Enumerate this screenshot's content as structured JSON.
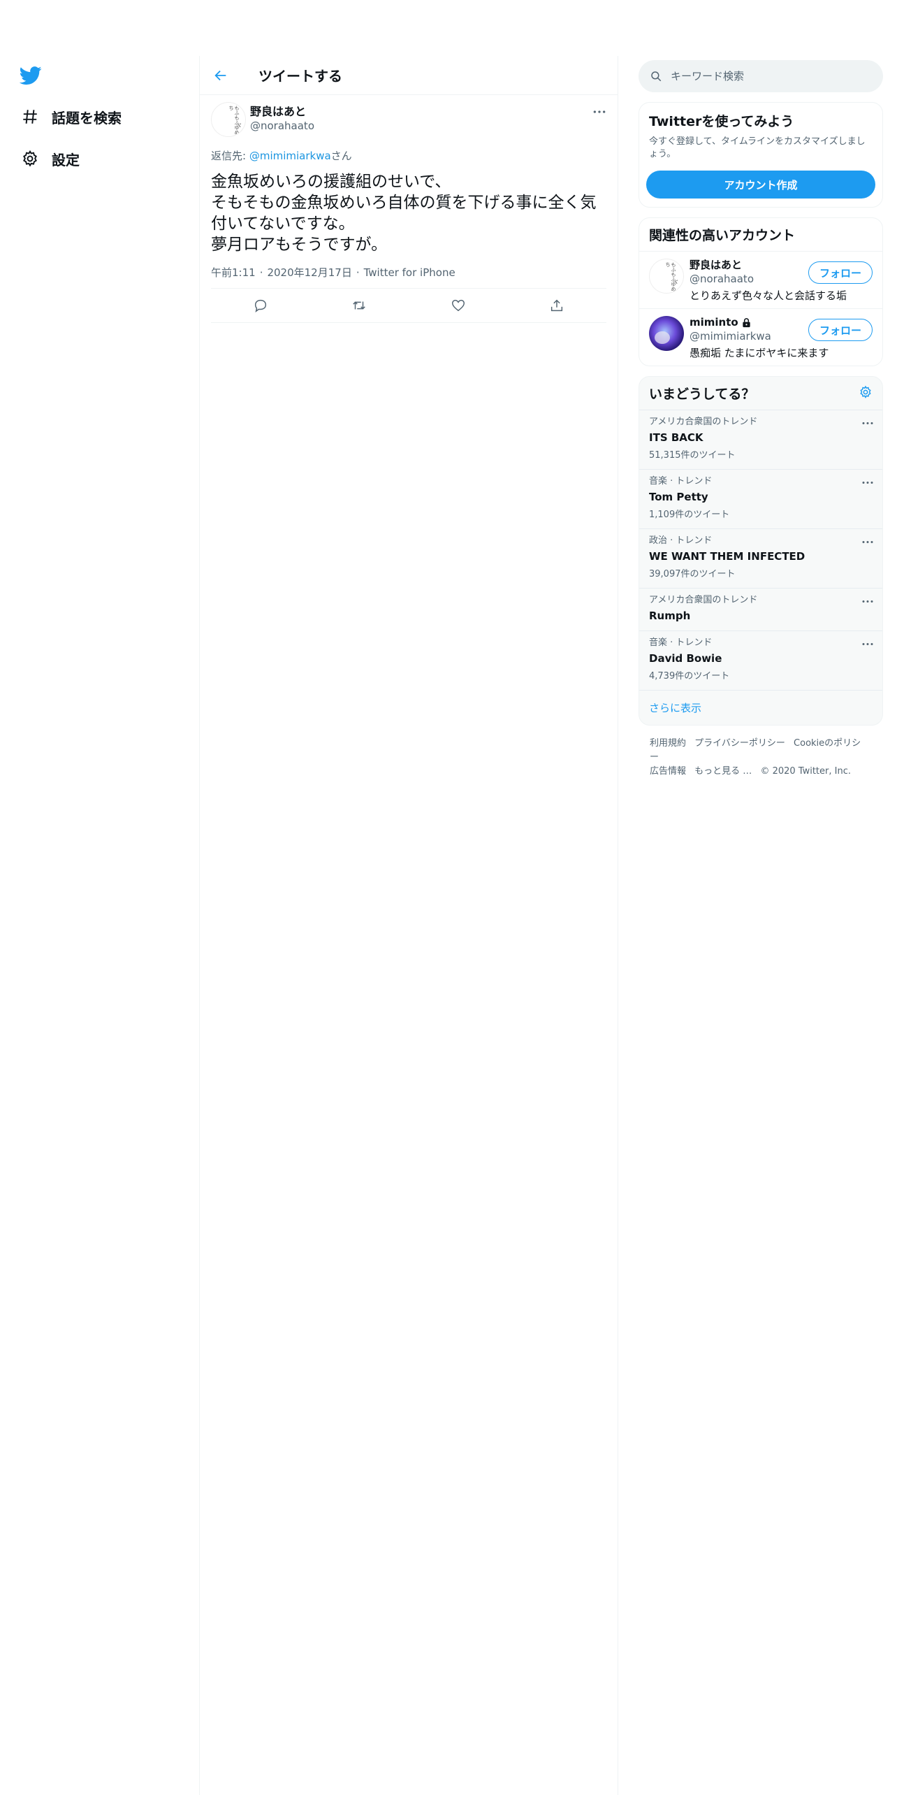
{
  "nav": {
    "items": [
      {
        "label": "話題を検索",
        "icon": "hash-icon"
      },
      {
        "label": "設定",
        "icon": "gear-icon"
      }
    ]
  },
  "header": {
    "title": "ツイートする"
  },
  "tweet": {
    "author_name": "野良はあと",
    "author_handle": "@norahaato",
    "reply_prefix": "返信先: ",
    "reply_mention": "@mimimiarkwa",
    "reply_suffix": "さん",
    "text": "金魚坂めいろの援護組のせいで、\nそもそもの金魚坂めいろ自体の質を下げる事に全く気付いてないですな。\n夢月ロアもそうですが。",
    "time": "午前1:11",
    "date": "2020年12月17日",
    "source": "Twitter for iPhone",
    "separator": "·"
  },
  "search": {
    "placeholder": "キーワード検索"
  },
  "signup": {
    "title": "Twitterを使ってみよう",
    "desc": "今すぐ登録して、タイムラインをカスタマイズしましょう。",
    "button": "アカウント作成"
  },
  "related": {
    "title": "関連性の高いアカウント",
    "follow_label": "フォロー",
    "accounts": [
      {
        "name": "野良はあと",
        "handle": "@norahaato",
        "bio": "とりあえず色々な人と会話する垢"
      },
      {
        "name": "miminto",
        "handle": "@mimimiarkwa",
        "bio": "愚痴垢 たまにボヤキに来ます"
      }
    ]
  },
  "trends": {
    "title": "いまどうしてる？",
    "items": [
      {
        "meta": "アメリカ合衆国のトレンド",
        "name": "ITS BACK",
        "count": "51,315件のツイート"
      },
      {
        "meta": "音楽 · トレンド",
        "name": "Tom Petty",
        "count": "1,109件のツイート"
      },
      {
        "meta": "政治 · トレンド",
        "name": "WE WANT THEM INFECTED",
        "count": "39,097件のツイート"
      },
      {
        "meta": "アメリカ合衆国のトレンド",
        "name": "Rumph",
        "count": ""
      },
      {
        "meta": "音楽 · トレンド",
        "name": "David Bowie",
        "count": "4,739件のツイート"
      }
    ],
    "show_more": "さらに表示"
  },
  "footer": {
    "links": [
      "利用規約",
      "プライバシーポリシー",
      "Cookieのポリシー",
      "広告情報",
      "もっと見る …",
      "© 2020 Twitter, Inc."
    ]
  },
  "avatar_text": "もふもふゆめち",
  "colors": {
    "accent": "#1d9bf0",
    "secondary_text": "#536471",
    "border": "#eff3f4"
  }
}
